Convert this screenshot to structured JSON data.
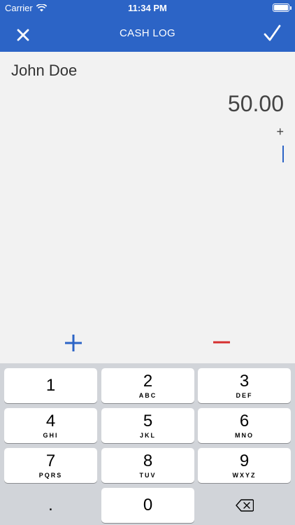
{
  "status_bar": {
    "carrier": "Carrier",
    "time": "11:34 PM"
  },
  "nav": {
    "title": "CASH LOG"
  },
  "entry": {
    "name": "John Doe",
    "amount": "50.00",
    "operator": "+"
  },
  "keypad": {
    "keys": [
      {
        "num": "1",
        "letters": ""
      },
      {
        "num": "2",
        "letters": "ABC"
      },
      {
        "num": "3",
        "letters": "DEF"
      },
      {
        "num": "4",
        "letters": "GHI"
      },
      {
        "num": "5",
        "letters": "JKL"
      },
      {
        "num": "6",
        "letters": "MNO"
      },
      {
        "num": "7",
        "letters": "PQRS"
      },
      {
        "num": "8",
        "letters": "TUV"
      },
      {
        "num": "9",
        "letters": "WXYZ"
      },
      {
        "num": ".",
        "letters": ""
      },
      {
        "num": "0",
        "letters": ""
      }
    ]
  },
  "icons": {
    "close": "close-icon",
    "check": "check-icon",
    "plus": "plus-icon",
    "minus": "minus-icon",
    "backspace": "backspace-icon",
    "wifi": "wifi-icon",
    "battery": "battery-icon"
  },
  "colors": {
    "brand": "#2c64c6",
    "minus": "#d63030",
    "keypad_bg": "#d1d4d9"
  }
}
